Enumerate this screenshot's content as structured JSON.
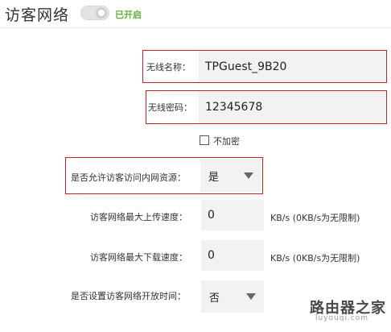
{
  "header": {
    "title": "访客网络",
    "toggle_status": "已开启",
    "toggle_color": "#5fb037"
  },
  "wireless_name": {
    "label": "无线名称：",
    "value": "TPGuest_9B20"
  },
  "wireless_password": {
    "label": "无线密码：",
    "value": "12345678"
  },
  "no_encrypt": {
    "label": "不加密",
    "checked": false
  },
  "allow_lan_access": {
    "label": "是否允许访客访问内网资源：",
    "selected": "是"
  },
  "max_upload": {
    "label": "访客网络最大上传速度：",
    "value": "0",
    "unit": "KB/s (0KB/s为无限制)"
  },
  "max_download": {
    "label": "访客网络最大下载速度：",
    "value": "0",
    "unit": "KB/s (0KB/s为无限制)"
  },
  "open_time": {
    "label": "是否设置访客网络开放时间：",
    "selected": "否"
  },
  "watermark": {
    "text": "路由器之家",
    "sub": "luyouqi.com"
  },
  "colors": {
    "highlight": "#cc2222",
    "field_bg": "#f2f2f2"
  }
}
